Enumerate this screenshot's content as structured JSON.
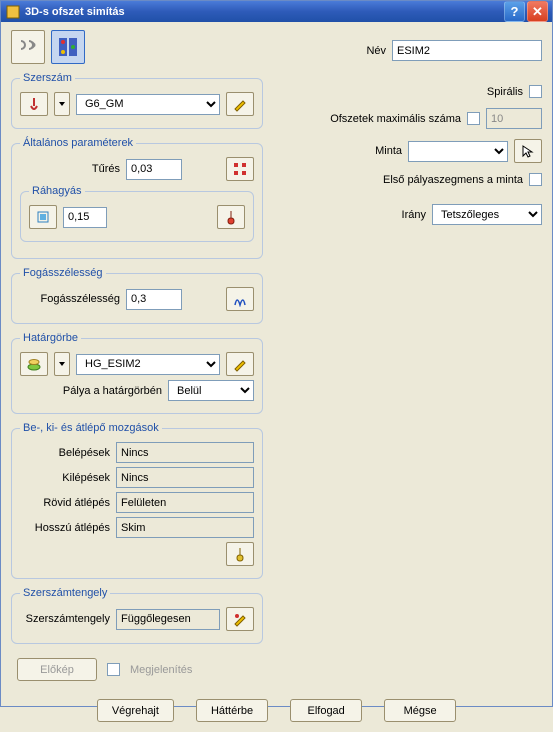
{
  "titlebar": {
    "title": "3D-s ofszet simítás"
  },
  "name": {
    "label": "Név",
    "value": "ESIM2"
  },
  "spiralis": {
    "label": "Spirális"
  },
  "ofszet_max": {
    "label": "Ofszetek maximális száma",
    "value": "10"
  },
  "minta": {
    "label": "Minta",
    "selected": ""
  },
  "elso_palya": {
    "label": "Első pályaszegmens a minta"
  },
  "irany": {
    "label": "Irány",
    "selected": "Tetszőleges"
  },
  "szerszam": {
    "legend": "Szerszám",
    "value": "G6_GM"
  },
  "alt_param": {
    "legend": "Általános paraméterek",
    "tures_label": "Tűrés",
    "tures_value": "0,03"
  },
  "rahagyas": {
    "legend": "Ráhagyás",
    "value": "0,15"
  },
  "fogas": {
    "legend": "Fogásszélesség",
    "label": "Fogásszélesség",
    "value": "0,3"
  },
  "hatar": {
    "legend": "Határgörbe",
    "value": "HG_ESIM2",
    "palya_label": "Pálya a határgörbén",
    "palya_value": "Belül"
  },
  "mozgasok": {
    "legend": "Be-, ki- és átlépő mozgások",
    "belepesek_label": "Belépések",
    "belepesek_value": "Nincs",
    "kilepesek_label": "Kilépések",
    "kilepesek_value": "Nincs",
    "rovid_label": "Rövid átlépés",
    "rovid_value": "Felületen",
    "hosszu_label": "Hosszú átlépés",
    "hosszu_value": "Skim"
  },
  "tengely": {
    "legend": "Szerszámtengely",
    "label": "Szerszámtengely",
    "value": "Függőlegesen"
  },
  "preview": {
    "button": "Előkép",
    "checkbox": "Megjelenítés"
  },
  "buttons": {
    "vegrehajt": "Végrehajt",
    "hatterbe": "Háttérbe",
    "elfogad": "Elfogad",
    "megse": "Mégse"
  }
}
